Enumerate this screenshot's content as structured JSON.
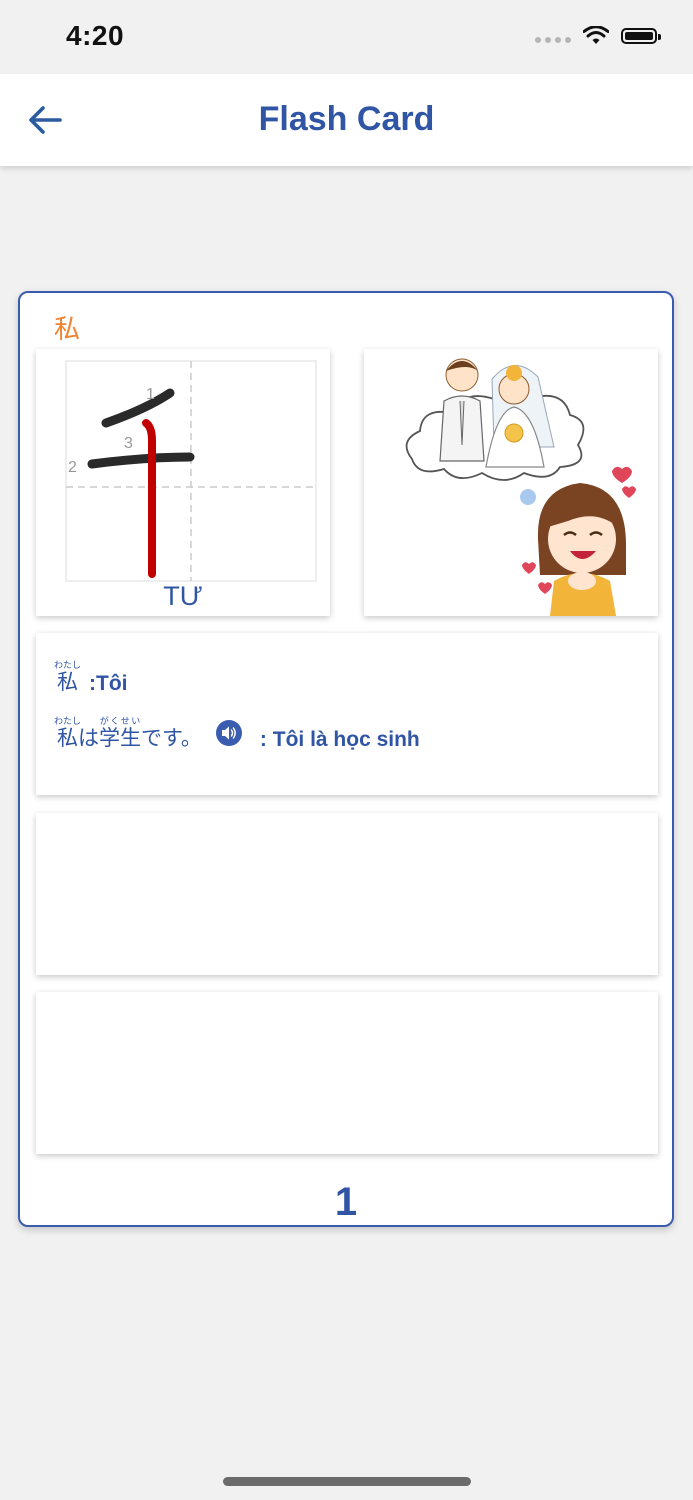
{
  "status_bar": {
    "time": "4:20"
  },
  "header": {
    "title": "Flash Card"
  },
  "card": {
    "kanji": "私",
    "reading": "TƯ",
    "stroke_numbers": [
      "1",
      "2",
      "3"
    ],
    "vocab": {
      "word": "私",
      "furigana": "わたし",
      "meaning": ":Tôi"
    },
    "example": {
      "word1": "私",
      "word1_furigana": "わたし",
      "particle": "は",
      "word2": "学生",
      "word2_furigana": "がくせい",
      "ending": "です。",
      "meaning": ": Tôi là học sinh"
    },
    "page_number": "1"
  },
  "colors": {
    "accent": "#2f55a4",
    "kanji": "#f0832e",
    "stroke_active": "#c00000"
  },
  "icons": {
    "back": "arrow-left-icon",
    "audio": "speaker-icon"
  }
}
